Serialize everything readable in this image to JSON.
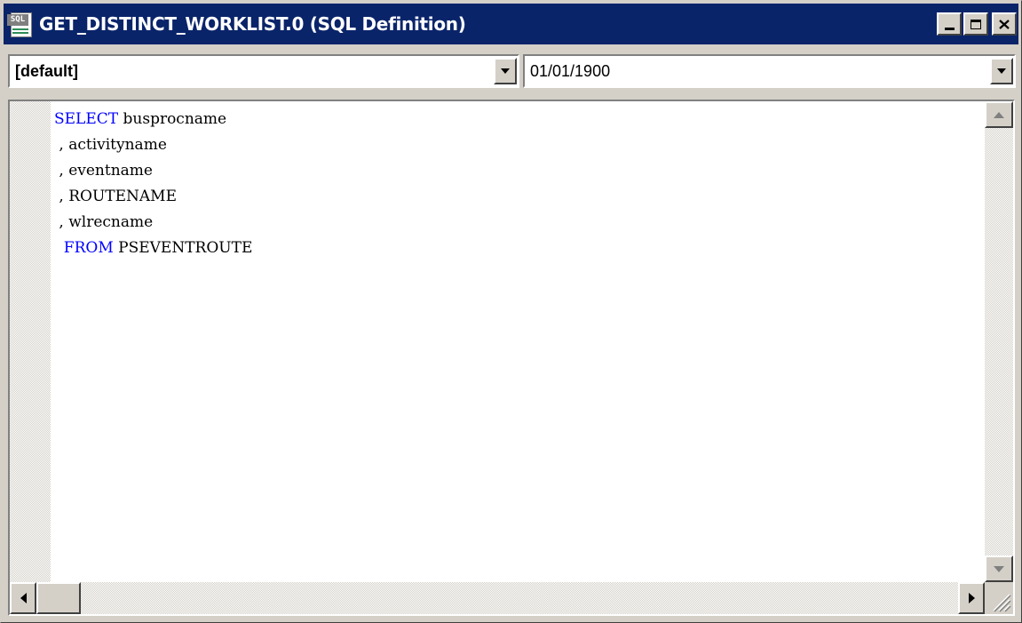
{
  "window": {
    "title": "GET_DISTINCT_WORKLIST.0 (SQL Definition)",
    "icon": "sql-definition-icon",
    "icon_label": "SQL"
  },
  "selectors": {
    "market": {
      "value": "[default]"
    },
    "effective_date": {
      "value": "01/01/1900"
    }
  },
  "editor": {
    "lines": [
      {
        "keyword": "SELECT",
        "text": " busprocname"
      },
      {
        "keyword": "",
        "text": " , activityname"
      },
      {
        "keyword": "",
        "text": " , eventname"
      },
      {
        "keyword": "",
        "text": " , ROUTENAME"
      },
      {
        "keyword": "",
        "text": " , wlrecname"
      },
      {
        "keyword": "  FROM",
        "text": " PSEVENTROUTE"
      }
    ]
  },
  "colors": {
    "titlebar": "#0a246a",
    "keyword": "#0000ff",
    "face": "#d4d0c8"
  }
}
